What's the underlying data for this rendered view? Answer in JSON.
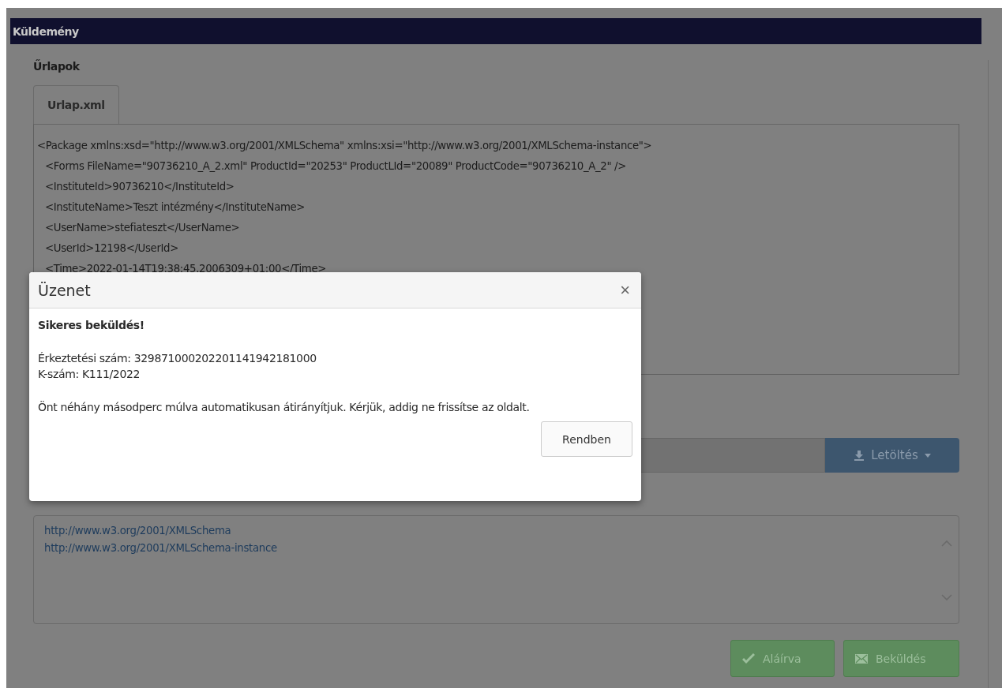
{
  "window": {
    "title": "Küldemény"
  },
  "section": {
    "title": "Űrlapok"
  },
  "tabs": [
    {
      "label": "Urlap.xml",
      "selected": true
    }
  ],
  "xml": {
    "text": "<Package xmlns:xsd=\"http://www.w3.org/2001/XMLSchema\" xmlns:xsi=\"http://www.w3.org/2001/XMLSchema-instance\">",
    "children": [
      {
        "text": "<Forms FileName=\"90736210_A_2.xml\" ProductId=\"20253\" ProductLId=\"20089\" ProductCode=\"90736210_A_2\" />"
      },
      {
        "text": "<InstituteId>90736210</InstituteId>"
      },
      {
        "text": "<InstituteName>Teszt intézmény</InstituteName>"
      },
      {
        "text": "<UserName>stefiateszt</UserName>"
      },
      {
        "text": "<UserId>12198</UserId>"
      },
      {
        "text": "<Time>2022-01-14T19:38:45.2006309+01:00</Time>"
      }
    ]
  },
  "download_button": {
    "label": "Letöltés"
  },
  "namespaces": [
    "http://www.w3.org/2001/XMLSchema",
    "http://www.w3.org/2001/XMLSchema-instance"
  ],
  "actions": [
    {
      "kind": "sign",
      "label": "Aláírva",
      "disabled": true
    },
    {
      "kind": "send",
      "label": "Beküldés",
      "disabled": true
    }
  ],
  "dialog": {
    "title": "Üzenet",
    "close": "×",
    "heading": "Sikeres beküldés!",
    "details": [
      "Érkeztetési szám: 329871000202201141942181000",
      "K-szám: K111/2022"
    ],
    "message": "Önt néhány másodperc múlva automatikusan átirányítjuk. Kérjük, addig ne frissítse az oldalt.",
    "ok": "Rendben"
  }
}
